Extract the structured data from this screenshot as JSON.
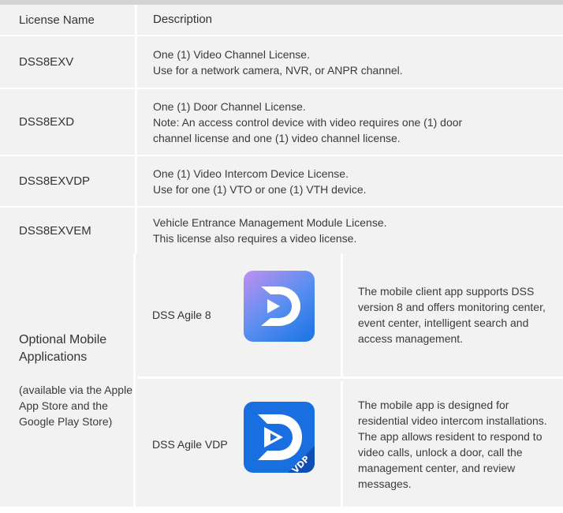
{
  "license_table": {
    "headers": {
      "name": "License Name",
      "description": "Description"
    },
    "rows": [
      {
        "name": "DSS8EXV",
        "lines": [
          "One (1) Video Channel License.",
          "Use for a network camera, NVR, or ANPR channel."
        ]
      },
      {
        "name": "DSS8EXD",
        "lines": [
          "One (1) Door Channel License.",
          "Note: An access control device with video requires one (1) door",
          "channel license and one (1) video channel license."
        ]
      },
      {
        "name": "DSS8EXVDP",
        "lines": [
          "One (1) Video Intercom Device License.",
          "Use for one (1) VTO or one (1) VTH device."
        ]
      },
      {
        "name": "DSS8EXVEM",
        "lines": [
          "Vehicle Entrance Management Module License.",
          "This license also requires a video license."
        ]
      }
    ]
  },
  "apps_table": {
    "title": "Optional Mobile Applications",
    "subtitle": "(available via the Apple App Store and the Google Play Store)",
    "apps": [
      {
        "name": "DSS Agile 8",
        "icon": "dss-agile-8-logo-icon",
        "description": "The mobile client app supports DSS version 8 and offers monitoring center, event center, intelligent search and access management."
      },
      {
        "name": "DSS Agile VDP",
        "icon": "dss-agile-vdp-logo-icon",
        "badge": "VDP",
        "description": "The mobile app is designed for residential video intercom installations. The app allows resident to respond to video calls, unlock a door, call the management center, and review messages."
      }
    ]
  },
  "colors": {
    "row_bg": "#f2f2f2",
    "divider": "#ffffff",
    "topbar": "#d4d4d4",
    "icon1_gradient": [
      "#b98ef0",
      "#2f7de0"
    ],
    "icon2_blue": "#1a6fe0"
  }
}
